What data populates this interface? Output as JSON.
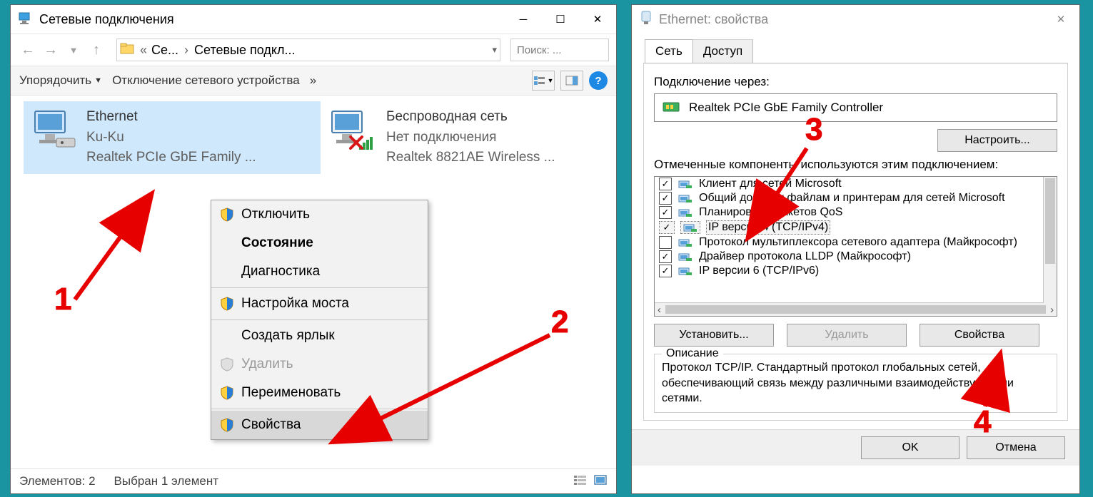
{
  "window1": {
    "title": "Сетевые подключения",
    "breadcrumb": {
      "part1": "Се...",
      "part2": "Сетевые подкл..."
    },
    "search_placeholder": "Поиск: ...",
    "commandbar": {
      "organize": "Упорядочить",
      "disable": "Отключение сетевого устройства",
      "more": "»"
    },
    "adapters": [
      {
        "name": "Ethernet",
        "subtitle": "Ku-Ku",
        "device": "Realtek PCIe GbE Family ..."
      },
      {
        "name": "Беспроводная сеть",
        "subtitle": "Нет подключения",
        "device": "Realtek 8821AE Wireless ..."
      }
    ],
    "context_menu": {
      "disable": "Отключить",
      "status": "Состояние",
      "diagnose": "Диагностика",
      "bridge": "Настройка моста",
      "shortcut": "Создать ярлык",
      "delete": "Удалить",
      "rename": "Переименовать",
      "properties": "Свойства"
    },
    "statusbar": {
      "items": "Элементов: 2",
      "selected": "Выбран 1 элемент"
    }
  },
  "window2": {
    "title": "Ethernet: свойства",
    "tabs": {
      "network": "Сеть",
      "access": "Доступ"
    },
    "connect_via_label": "Подключение через:",
    "adapter_name": "Realtek PCIe GbE Family Controller",
    "configure_btn": "Настроить...",
    "components_label": "Отмеченные компоненты используются этим подключением:",
    "components": [
      {
        "checked": true,
        "label": "Клиент для сетей Microsoft"
      },
      {
        "checked": true,
        "label": "Общий доступ к файлам и принтерам для сетей Microsoft"
      },
      {
        "checked": true,
        "label": "Планировщик пакетов QoS"
      },
      {
        "checked": true,
        "label": "IP версии 4 (TCP/IPv4)",
        "highlight": true
      },
      {
        "checked": false,
        "label": "Протокол мультиплексора сетевого адаптера (Майкрософт)"
      },
      {
        "checked": true,
        "label": "Драйвер протокола LLDP (Майкрософт)"
      },
      {
        "checked": true,
        "label": "IP версии 6 (TCP/IPv6)"
      }
    ],
    "install_btn": "Установить...",
    "remove_btn": "Удалить",
    "props_btn": "Свойства",
    "desc_legend": "Описание",
    "description": "Протокол TCP/IP. Стандартный протокол глобальных сетей, обеспечивающий связь между различными взаимодействующими сетями.",
    "ok": "OK",
    "cancel": "Отмена"
  },
  "annotations": {
    "a1": "1",
    "a2": "2",
    "a3": "3",
    "a4": "4"
  }
}
